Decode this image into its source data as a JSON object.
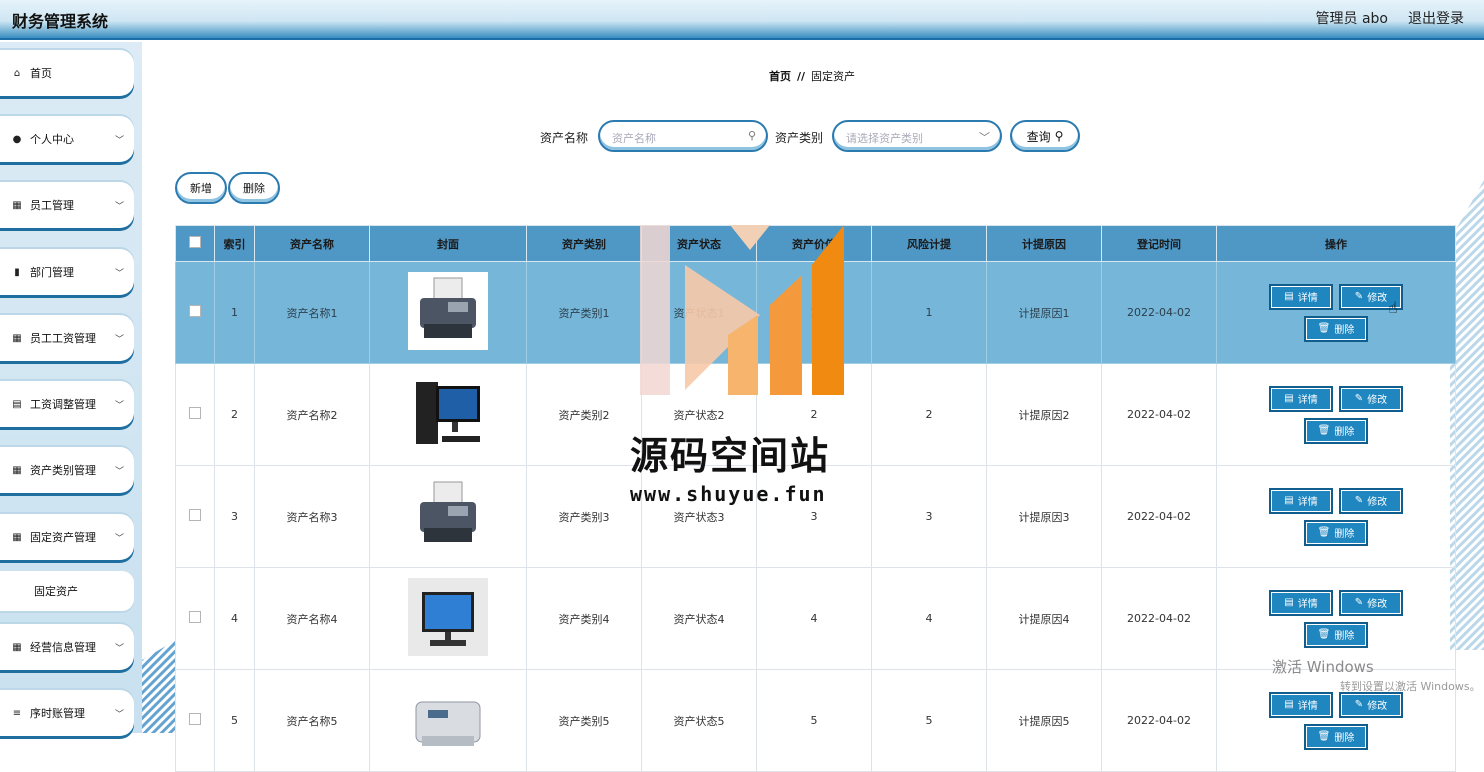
{
  "app": {
    "title": "财务管理系统",
    "user": "管理员 abo",
    "logout": "退出登录"
  },
  "sidebar": {
    "items": [
      {
        "label": "首页",
        "icon": "home-icon"
      },
      {
        "label": "个人中心",
        "icon": "user-icon"
      },
      {
        "label": "员工管理",
        "icon": "grid-icon"
      },
      {
        "label": "部门管理",
        "icon": "bar-chart-icon"
      },
      {
        "label": "员工工资管理",
        "icon": "grid-icon"
      },
      {
        "label": "工资调整管理",
        "icon": "clipboard-icon"
      },
      {
        "label": "资产类别管理",
        "icon": "grid-icon"
      },
      {
        "label": "固定资产管理",
        "icon": "grid-icon"
      },
      {
        "label": "经营信息管理",
        "icon": "grid-icon"
      },
      {
        "label": "序时账管理",
        "icon": "list-icon"
      }
    ],
    "sub_item": "固定资产"
  },
  "breadcrumb": {
    "home": "首页",
    "separator": "//",
    "current": "固定资产"
  },
  "search": {
    "name_label": "资产名称",
    "name_placeholder": "资产名称",
    "type_label": "资产类别",
    "type_placeholder": "请选择资产类别",
    "query": "查询"
  },
  "toolbar": {
    "add": "新增",
    "delete": "删除"
  },
  "table": {
    "headers": [
      "",
      "索引",
      "资产名称",
      "封面",
      "资产类别",
      "资产状态",
      "资产价值",
      "风险计提",
      "计提原因",
      "登记时间",
      "操作"
    ],
    "rows": [
      {
        "idx": "1",
        "name": "资产名称1",
        "type": "资产类别1",
        "status": "资产状态1",
        "value": "1",
        "risk": "1",
        "reason": "计提原因1",
        "date": "2022-04-02"
      },
      {
        "idx": "2",
        "name": "资产名称2",
        "type": "资产类别2",
        "status": "资产状态2",
        "value": "2",
        "risk": "2",
        "reason": "计提原因2",
        "date": "2022-04-02"
      },
      {
        "idx": "3",
        "name": "资产名称3",
        "type": "资产类别3",
        "status": "资产状态3",
        "value": "3",
        "risk": "3",
        "reason": "计提原因3",
        "date": "2022-04-02"
      },
      {
        "idx": "4",
        "name": "资产名称4",
        "type": "资产类别4",
        "status": "资产状态4",
        "value": "4",
        "risk": "4",
        "reason": "计提原因4",
        "date": "2022-04-02"
      },
      {
        "idx": "5",
        "name": "资产名称5",
        "type": "资产类别5",
        "status": "资产状态5",
        "value": "5",
        "risk": "5",
        "reason": "计提原因5",
        "date": "2022-04-02"
      }
    ],
    "actions": {
      "detail": "详情",
      "edit": "修改",
      "delete": "删除"
    }
  },
  "watermark": {
    "title": "源码空间站",
    "url": "www.shuyue.fun"
  },
  "os_notice": {
    "line1": "激活 Windows",
    "line2": "转到设置以激活 Windows。"
  },
  "colors": {
    "primary": "#1f86c0",
    "header": "#4f97c5",
    "selected_row": "#76b7d9"
  }
}
